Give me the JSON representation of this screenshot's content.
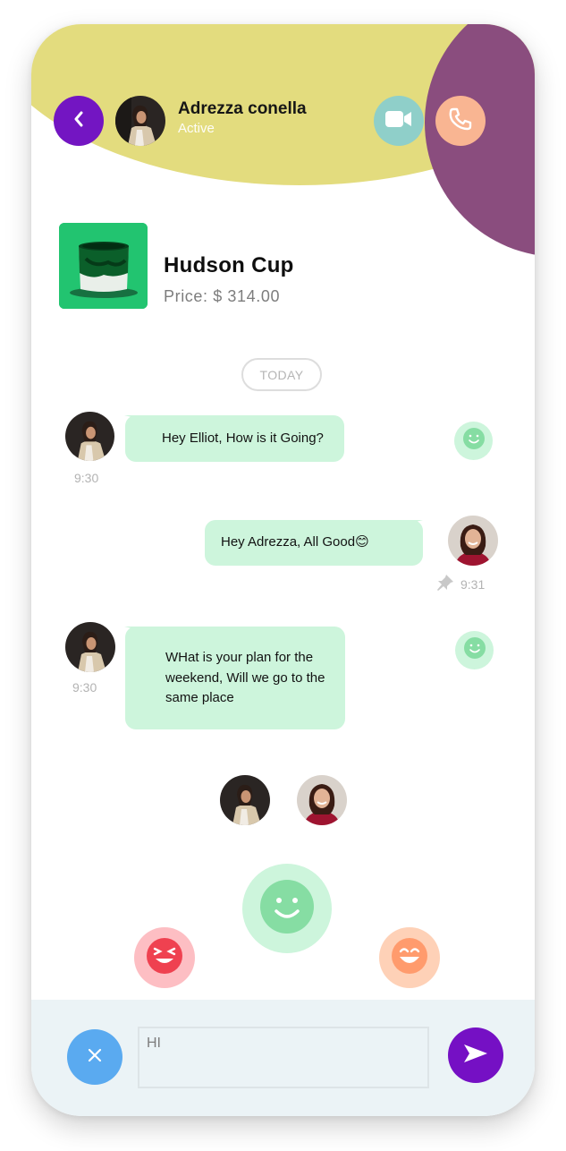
{
  "header": {
    "contact_name": "Adrezza conella",
    "status": "Active",
    "back_icon": "chevron-left-icon",
    "video_icon": "video-camera-icon",
    "call_icon": "phone-icon"
  },
  "product": {
    "name": "Hudson Cup",
    "price": "Price: $ 314.00"
  },
  "date_separator": "TODAY",
  "messages": [
    {
      "sender": "contact",
      "text": "Hey Elliot, How is it Going?",
      "time": "9:30"
    },
    {
      "sender": "me",
      "text": "Hey Adrezza, All Good😊",
      "time": "9:31"
    },
    {
      "sender": "contact",
      "text": "WHat is your plan for the weekend, Will we go to the same place",
      "time": "9:30"
    }
  ],
  "composer": {
    "value": "HI",
    "close_icon": "close-icon",
    "send_icon": "send-icon"
  },
  "colors": {
    "accent_purple": "#7315c2",
    "header_yellow": "#e3dc7e",
    "corner_purple": "#8a4d7e",
    "bubble_green": "#cdf5dc",
    "emoji_green": "#86dda3",
    "video_teal": "#8fcfc9",
    "call_peach": "#f9b592",
    "close_blue": "#5aaaf0"
  }
}
